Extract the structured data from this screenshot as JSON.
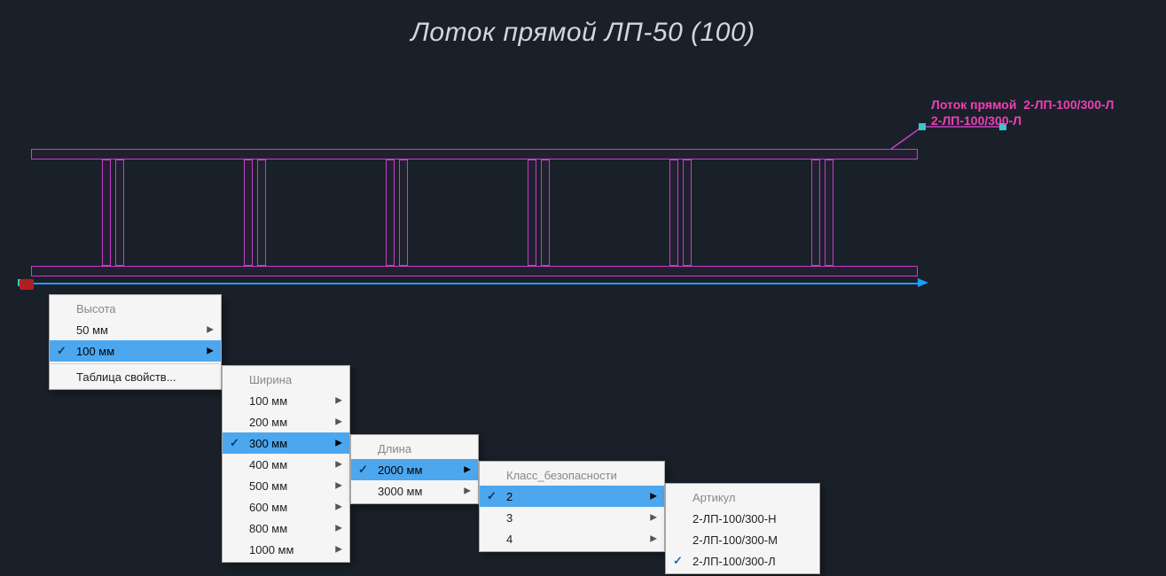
{
  "title": "Лоток прямой ЛП-50 (100)",
  "annotation": {
    "line1a": "Лоток прямой",
    "line1b": "2-ЛП-100/300-Л",
    "line2": "2-ЛП-100/300-Л"
  },
  "menus": {
    "height": {
      "header": "Высота",
      "items": [
        {
          "label": "50 мм",
          "sub": true,
          "checked": false,
          "sel": false
        },
        {
          "label": "100 мм",
          "sub": true,
          "checked": true,
          "sel": true
        }
      ],
      "extra": "Таблица свойств..."
    },
    "width": {
      "header": "Ширина",
      "items": [
        {
          "label": "100 мм",
          "sub": true
        },
        {
          "label": "200 мм",
          "sub": true
        },
        {
          "label": "300 мм",
          "sub": true,
          "checked": true,
          "sel": true
        },
        {
          "label": "400 мм",
          "sub": true
        },
        {
          "label": "500 мм",
          "sub": true
        },
        {
          "label": "600 мм",
          "sub": true
        },
        {
          "label": "800 мм",
          "sub": true
        },
        {
          "label": "1000 мм",
          "sub": true
        }
      ]
    },
    "length": {
      "header": "Длина",
      "items": [
        {
          "label": "2000 мм",
          "sub": true,
          "checked": true,
          "sel": true
        },
        {
          "label": "3000 мм",
          "sub": true
        }
      ]
    },
    "safety": {
      "header": "Класс_безопасности",
      "items": [
        {
          "label": "2",
          "sub": true,
          "checked": true,
          "sel": true
        },
        {
          "label": "3",
          "sub": true
        },
        {
          "label": "4",
          "sub": true
        }
      ]
    },
    "article": {
      "header": "Артикул",
      "items": [
        {
          "label": "2-ЛП-100/300-Н"
        },
        {
          "label": "2-ЛП-100/300-М"
        },
        {
          "label": "2-ЛП-100/300-Л",
          "checked": true
        }
      ]
    }
  }
}
